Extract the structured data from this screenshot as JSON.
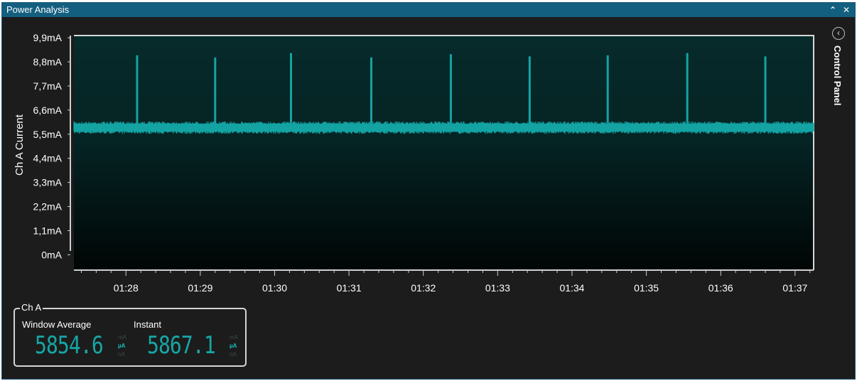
{
  "window": {
    "title": "Power Analysis",
    "minimize_glyph": "⌃",
    "close_glyph": "✕"
  },
  "side_panel": {
    "label": "Control Panel",
    "icon": "chevron-left-circle-icon",
    "icon_glyph": "‹"
  },
  "meter": {
    "channel": "Ch A",
    "window_average_label": "Window Average",
    "window_average_value": "5854.6",
    "instant_label": "Instant",
    "instant_value": "5867.1",
    "unit_options": [
      "mA",
      "µA",
      "nA"
    ],
    "selected_unit": "µA"
  },
  "colors": {
    "trace": "#14a3a3",
    "accent": "#17a6a6",
    "title_bar": "#135f7f",
    "plot_top": "#072a2a",
    "plot_bottom": "#010505"
  },
  "chart_data": {
    "type": "line",
    "title": "",
    "ylabel": "Ch A Current",
    "xlabel": "",
    "y_ticks": [
      "9,9mA",
      "8,8mA",
      "7,7mA",
      "6,6mA",
      "5,5mA",
      "4,4mA",
      "3,3mA",
      "2,2mA",
      "1,1mA",
      "0mA"
    ],
    "y_tick_values": [
      9.9,
      8.8,
      7.7,
      6.6,
      5.5,
      4.4,
      3.3,
      2.2,
      1.1,
      0
    ],
    "ylim": [
      -0.7,
      10.0
    ],
    "y_unit": "mA",
    "x_ticks": [
      "01:28",
      "01:29",
      "01:30",
      "01:31",
      "01:32",
      "01:33",
      "01:34",
      "01:35",
      "01:36",
      "01:37"
    ],
    "x_tick_seconds": [
      88,
      89,
      90,
      91,
      92,
      93,
      94,
      95,
      96,
      97
    ],
    "xlim_seconds": [
      87.3,
      97.25
    ],
    "baseline_mA": [
      5.55,
      6.05
    ],
    "series": [
      {
        "spikes": [
          {
            "t": 88.15,
            "peak_mA": 9.1
          },
          {
            "t": 89.2,
            "peak_mA": 9.0
          },
          {
            "t": 90.22,
            "peak_mA": 9.2
          },
          {
            "t": 91.3,
            "peak_mA": 9.0
          },
          {
            "t": 92.37,
            "peak_mA": 9.15
          },
          {
            "t": 93.43,
            "peak_mA": 9.05
          },
          {
            "t": 94.48,
            "peak_mA": 9.1
          },
          {
            "t": 95.55,
            "peak_mA": 9.2
          },
          {
            "t": 96.6,
            "peak_mA": 9.05
          }
        ]
      }
    ],
    "grid": false,
    "legend": "none"
  }
}
